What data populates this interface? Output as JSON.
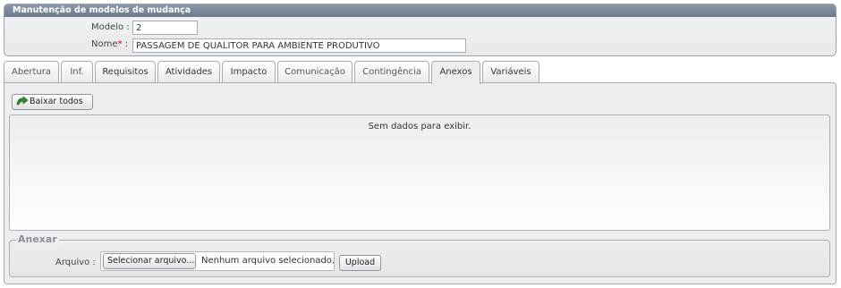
{
  "panel": {
    "title": "Manutenção de modelos de mudança",
    "modelo_label": "Modelo :",
    "modelo_value": "2",
    "nome_label": "Nome",
    "nome_required": "*",
    "nome_colon": ":",
    "nome_value": "PASSAGEM DE QUALITOR PARA AMBIENTE PRODUTIVO"
  },
  "tabs": [
    {
      "label": "Abertura"
    },
    {
      "label": "Inf."
    },
    {
      "label": "Requisitos"
    },
    {
      "label": "Atividades"
    },
    {
      "label": "Impacto"
    },
    {
      "label": "Comunicação"
    },
    {
      "label": "Contingência"
    },
    {
      "label": "Anexos"
    },
    {
      "label": "Variáveis"
    }
  ],
  "active_tab": "Anexos",
  "anexos": {
    "download_all_label": "Baixar todos",
    "empty_message": "Sem dados para exibir.",
    "fieldset_legend": "Anexar",
    "arquivo_label": "Arquivo :",
    "select_file_label": "Selecionar arquivo...",
    "no_file_text": "Nenhum arquivo selecionado.",
    "upload_label": "Upload"
  },
  "colors": {
    "header": "#7a8696",
    "required": "#d0021b",
    "download_icon": "#2e8b2e"
  }
}
